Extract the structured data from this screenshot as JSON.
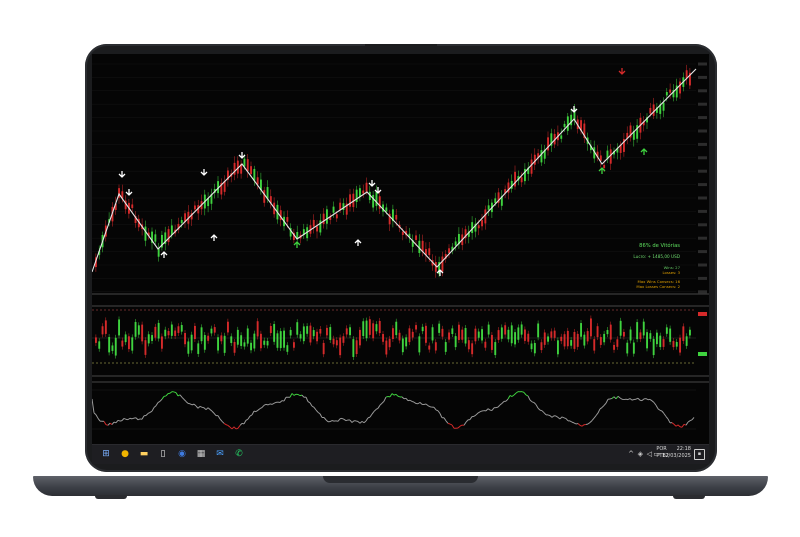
{
  "colors": {
    "bull": "#3fd33f",
    "bear": "#d52a2a",
    "zigzag": "#e6e6e6",
    "panel_bg": "#050505",
    "laptop": "#1b1c1e"
  },
  "stats": {
    "title": "86% de Vitórias",
    "result": "Lucro: + 1485,00 USD",
    "wins": "Wins: 27",
    "losses": "Losses: 3",
    "max_wins": "Max Wins Consecs: 16",
    "max_losses": "Max Losses Consecs: 2"
  },
  "taskbar": {
    "apps": [
      "windows-icon",
      "chrome-icon",
      "file-explorer-icon",
      "document-icon",
      "media-icon",
      "calculator-icon",
      "mail-icon",
      "whatsapp-icon"
    ],
    "language": "POR",
    "keyboard": "PTB2",
    "time": "22:18",
    "date": "12/03/2025"
  },
  "chart_data": [
    {
      "type": "candlestick",
      "panel": "price",
      "zigzag": [
        "low",
        "high",
        "low",
        "high",
        "low",
        "high",
        "low",
        "high"
      ],
      "signals_down": 8,
      "signals_up": 7
    },
    {
      "type": "bar",
      "panel": "oscillator-1"
    },
    {
      "type": "line",
      "panel": "oscillator-2"
    }
  ]
}
